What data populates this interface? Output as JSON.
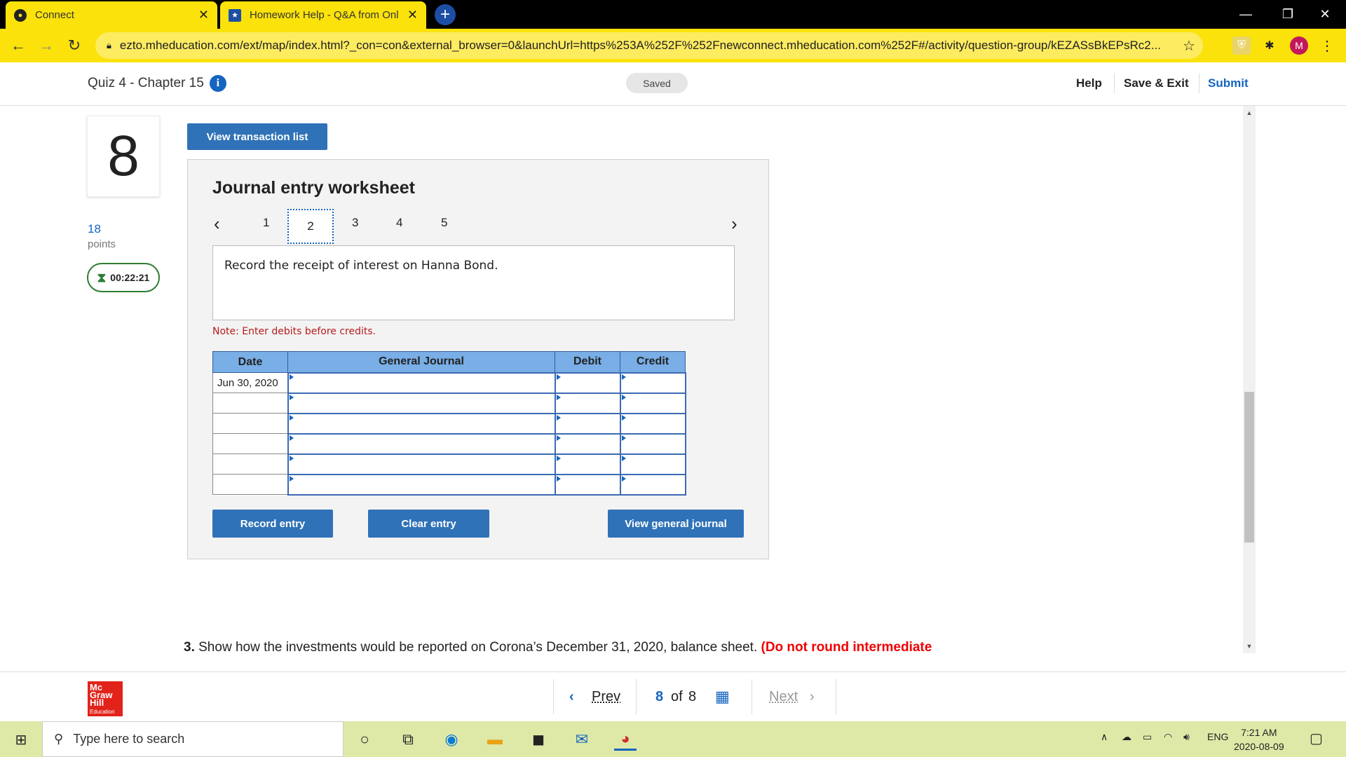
{
  "browser": {
    "tabs": [
      {
        "title": "Connect"
      },
      {
        "title": "Homework Help - Q&A from Onl"
      }
    ],
    "new_tab": "+",
    "url": "ezto.mheducation.com/ext/map/index.html?_con=con&external_browser=0&launchUrl=https%253A%252F%252Fnewconnect.mheducation.com%252F#/activity/question-group/kEZASsBkEPsRc2...",
    "profile_initial": "M"
  },
  "header": {
    "quiz_title": "Quiz 4 - Chapter 15",
    "status": "Saved",
    "help": "Help",
    "save_exit": "Save & Exit",
    "submit": "Submit"
  },
  "question": {
    "number": "8",
    "points": "18",
    "points_label": "points",
    "timer": "00:22:21"
  },
  "main": {
    "view_transactions": "View transaction list",
    "worksheet_title": "Journal entry worksheet",
    "nav_tabs": [
      "1",
      "2",
      "3",
      "4",
      "5"
    ],
    "active_tab": "2",
    "prompt": "Record the receipt of interest on Hanna Bond.",
    "note": "Note: Enter debits before credits.",
    "table": {
      "headers": [
        "Date",
        "General Journal",
        "Debit",
        "Credit"
      ],
      "rows": [
        {
          "date": "Jun 30, 2020"
        },
        {
          "date": ""
        },
        {
          "date": ""
        },
        {
          "date": ""
        },
        {
          "date": ""
        },
        {
          "date": ""
        }
      ]
    },
    "record_entry": "Record entry",
    "clear_entry": "Clear entry",
    "view_journal": "View general journal",
    "q3_number": "3.",
    "q3_text": " Show how the investments would be reported on Corona’s December 31, 2020, balance sheet. ",
    "q3_red": "(Do not round intermediate"
  },
  "footer": {
    "logo_lines": [
      "Mc",
      "Graw",
      "Hill"
    ],
    "logo_sub": "Education",
    "prev": "Prev",
    "current": "8",
    "of": "of",
    "total": "8",
    "next": "Next"
  },
  "taskbar": {
    "search_placeholder": "Type here to search",
    "lang": "ENG",
    "time": "7:21 AM",
    "date": "2020-08-09"
  },
  "colors": {
    "browser_accent": "#fbe20b",
    "primary_blue": "#2f72b7",
    "table_header": "#79aee6",
    "note_red": "#b71c1c",
    "timer_green": "#2e7d32"
  }
}
